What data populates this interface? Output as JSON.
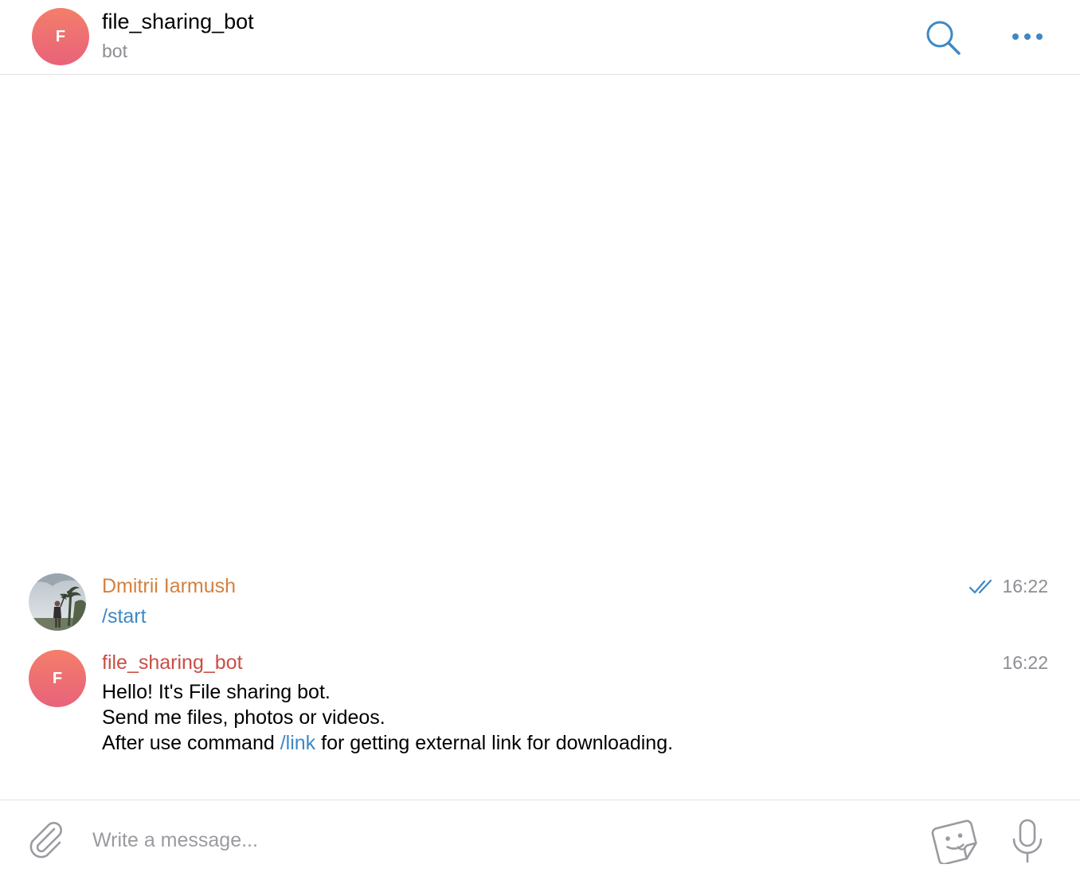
{
  "header": {
    "avatar_initial": "F",
    "title": "file_sharing_bot",
    "subtitle": "bot",
    "search_icon": "search-icon",
    "more_icon": "more-horizontal-icon"
  },
  "messages": [
    {
      "sender": "Dmitrii Iarmush",
      "sender_color": "#d3813f",
      "time": "16:22",
      "status": "read",
      "text": "/start"
    },
    {
      "avatar_initial": "F",
      "sender": "file_sharing_bot",
      "sender_color": "#c94f45",
      "time": "16:22",
      "lines": [
        "Hello! It's File sharing bot.",
        "Send me files, photos or videos."
      ],
      "line3_before": "After use command ",
      "line3_link": "/link",
      "line3_after": " for getting external link for downloading."
    }
  ],
  "composer": {
    "placeholder": "Write a message...",
    "attach_icon": "paperclip-icon",
    "sticker_icon": "sticker-icon",
    "mic_icon": "microphone-icon"
  },
  "colors": {
    "accent": "#3e88c5",
    "avatar_gradient_top": "#f47e6a",
    "avatar_gradient_bottom": "#e8627a",
    "secondary_text": "#8d8d93"
  }
}
